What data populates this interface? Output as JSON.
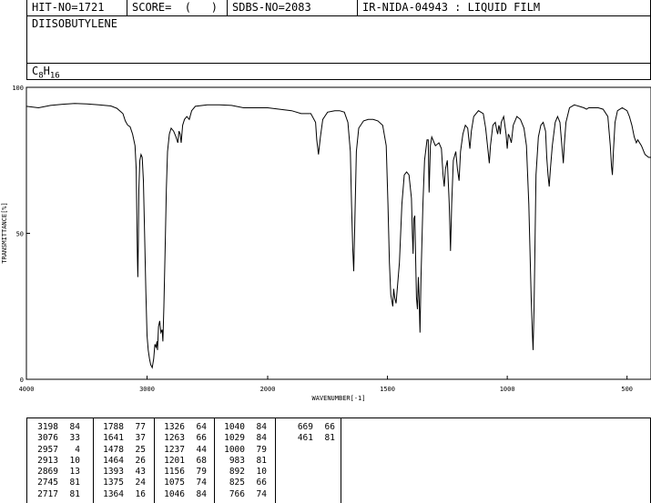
{
  "header": {
    "hit_no": "HIT-NO=1721",
    "score": "SCORE=  (   )",
    "sdbs_no": "SDBS-NO=2083",
    "ir_id": "IR-NIDA-04943 : LIQUID FILM"
  },
  "compound_name": "DIISOBUTYLENE",
  "formula": {
    "prefix": "C",
    "sub1": "8",
    "mid": "H",
    "sub2": "16"
  },
  "chart_data": {
    "type": "line",
    "xlabel": "WAVENUMBER[-1]",
    "ylabel": "TRANSMITTANCE[%]",
    "xlim": [
      4000,
      400
    ],
    "ylim": [
      0,
      100
    ],
    "x_ticks": [
      4000,
      3000,
      2000,
      1500,
      1000,
      500
    ],
    "y_ticks": [
      0,
      50,
      100
    ],
    "series": [
      {
        "points": [
          [
            4000,
            93.5
          ],
          [
            3900,
            93.0
          ],
          [
            3800,
            93.8
          ],
          [
            3700,
            94.2
          ],
          [
            3600,
            94.5
          ],
          [
            3500,
            94.3
          ],
          [
            3400,
            94.0
          ],
          [
            3300,
            93.6
          ],
          [
            3250,
            92.8
          ],
          [
            3200,
            91.0
          ],
          [
            3180,
            88.5
          ],
          [
            3160,
            87.0
          ],
          [
            3140,
            86.5
          ],
          [
            3120,
            84.0
          ],
          [
            3100,
            80.0
          ],
          [
            3090,
            72.0
          ],
          [
            3085,
            58.0
          ],
          [
            3080,
            42.0
          ],
          [
            3076,
            35.0
          ],
          [
            3072,
            48.0
          ],
          [
            3068,
            65.0
          ],
          [
            3060,
            75.0
          ],
          [
            3050,
            77.0
          ],
          [
            3040,
            76.0
          ],
          [
            3030,
            68.0
          ],
          [
            3020,
            50.0
          ],
          [
            3010,
            30.0
          ],
          [
            3000,
            15.0
          ],
          [
            2990,
            10.0
          ],
          [
            2980,
            7.0
          ],
          [
            2970,
            5.0
          ],
          [
            2957,
            4.0
          ],
          [
            2945,
            7.0
          ],
          [
            2935,
            12.0
          ],
          [
            2925,
            11.0
          ],
          [
            2918,
            13.0
          ],
          [
            2913,
            10.0
          ],
          [
            2905,
            18.0
          ],
          [
            2895,
            20.0
          ],
          [
            2885,
            16.0
          ],
          [
            2875,
            17.0
          ],
          [
            2869,
            13.0
          ],
          [
            2860,
            25.0
          ],
          [
            2850,
            45.0
          ],
          [
            2840,
            65.0
          ],
          [
            2830,
            78.0
          ],
          [
            2815,
            84.0
          ],
          [
            2800,
            86.0
          ],
          [
            2780,
            85.0
          ],
          [
            2760,
            83.0
          ],
          [
            2745,
            81.0
          ],
          [
            2735,
            85.0
          ],
          [
            2725,
            84.0
          ],
          [
            2717,
            81.0
          ],
          [
            2705,
            87.0
          ],
          [
            2690,
            89.0
          ],
          [
            2670,
            90.0
          ],
          [
            2650,
            89.0
          ],
          [
            2630,
            92.0
          ],
          [
            2600,
            93.5
          ],
          [
            2500,
            94.0
          ],
          [
            2400,
            94.0
          ],
          [
            2300,
            93.8
          ],
          [
            2200,
            93.0
          ],
          [
            2100,
            93.0
          ],
          [
            2000,
            93.0
          ],
          [
            1950,
            92.5
          ],
          [
            1900,
            92.0
          ],
          [
            1860,
            91.0
          ],
          [
            1820,
            91.0
          ],
          [
            1800,
            88.0
          ],
          [
            1795,
            82.0
          ],
          [
            1788,
            77.0
          ],
          [
            1780,
            83.0
          ],
          [
            1770,
            89.0
          ],
          [
            1750,
            91.5
          ],
          [
            1720,
            92.0
          ],
          [
            1700,
            92.0
          ],
          [
            1680,
            91.5
          ],
          [
            1665,
            88.0
          ],
          [
            1655,
            78.0
          ],
          [
            1650,
            60.0
          ],
          [
            1645,
            45.0
          ],
          [
            1641,
            37.0
          ],
          [
            1636,
            55.0
          ],
          [
            1630,
            78.0
          ],
          [
            1620,
            86.0
          ],
          [
            1600,
            88.5
          ],
          [
            1580,
            89.0
          ],
          [
            1560,
            89.0
          ],
          [
            1540,
            88.5
          ],
          [
            1520,
            87.0
          ],
          [
            1505,
            80.0
          ],
          [
            1498,
            60.0
          ],
          [
            1492,
            40.0
          ],
          [
            1486,
            29.0
          ],
          [
            1482,
            27.0
          ],
          [
            1478,
            25.0
          ],
          [
            1474,
            31.0
          ],
          [
            1470,
            28.0
          ],
          [
            1464,
            26.0
          ],
          [
            1458,
            32.0
          ],
          [
            1450,
            40.0
          ],
          [
            1440,
            60.0
          ],
          [
            1430,
            70.0
          ],
          [
            1420,
            71.0
          ],
          [
            1410,
            70.0
          ],
          [
            1400,
            62.0
          ],
          [
            1396,
            50.0
          ],
          [
            1393,
            43.0
          ],
          [
            1390,
            55.0
          ],
          [
            1386,
            56.0
          ],
          [
            1382,
            40.0
          ],
          [
            1379,
            28.0
          ],
          [
            1375,
            24.0
          ],
          [
            1371,
            35.0
          ],
          [
            1368,
            28.0
          ],
          [
            1364,
            16.0
          ],
          [
            1360,
            35.0
          ],
          [
            1352,
            60.0
          ],
          [
            1345,
            75.0
          ],
          [
            1335,
            82.0
          ],
          [
            1330,
            82.0
          ],
          [
            1326,
            64.0
          ],
          [
            1321,
            80.0
          ],
          [
            1315,
            83.0
          ],
          [
            1300,
            80.0
          ],
          [
            1285,
            81.0
          ],
          [
            1275,
            79.0
          ],
          [
            1268,
            70.0
          ],
          [
            1263,
            66.0
          ],
          [
            1258,
            72.0
          ],
          [
            1250,
            75.0
          ],
          [
            1242,
            60.0
          ],
          [
            1237,
            44.0
          ],
          [
            1232,
            60.0
          ],
          [
            1225,
            75.0
          ],
          [
            1215,
            78.0
          ],
          [
            1208,
            72.0
          ],
          [
            1201,
            68.0
          ],
          [
            1195,
            78.0
          ],
          [
            1185,
            84.0
          ],
          [
            1175,
            87.0
          ],
          [
            1165,
            86.0
          ],
          [
            1160,
            82.0
          ],
          [
            1156,
            79.0
          ],
          [
            1150,
            85.0
          ],
          [
            1140,
            90.0
          ],
          [
            1120,
            92.0
          ],
          [
            1100,
            91.0
          ],
          [
            1090,
            86.0
          ],
          [
            1080,
            78.0
          ],
          [
            1075,
            74.0
          ],
          [
            1070,
            80.0
          ],
          [
            1060,
            87.0
          ],
          [
            1050,
            88.0
          ],
          [
            1043,
            85.0
          ],
          [
            1040,
            84.0
          ],
          [
            1035,
            87.0
          ],
          [
            1032,
            86.0
          ],
          [
            1029,
            84.0
          ],
          [
            1025,
            88.0
          ],
          [
            1015,
            90.0
          ],
          [
            1005,
            84.0
          ],
          [
            1000,
            79.0
          ],
          [
            995,
            84.0
          ],
          [
            990,
            83.0
          ],
          [
            983,
            81.0
          ],
          [
            975,
            87.0
          ],
          [
            960,
            90.0
          ],
          [
            945,
            89.0
          ],
          [
            930,
            86.0
          ],
          [
            920,
            80.0
          ],
          [
            910,
            60.0
          ],
          [
            900,
            28.0
          ],
          [
            895,
            15.0
          ],
          [
            892,
            10.0
          ],
          [
            888,
            25.0
          ],
          [
            880,
            70.0
          ],
          [
            870,
            83.0
          ],
          [
            860,
            87.0
          ],
          [
            850,
            88.0
          ],
          [
            840,
            85.0
          ],
          [
            835,
            76.0
          ],
          [
            830,
            70.0
          ],
          [
            825,
            66.0
          ],
          [
            820,
            72.0
          ],
          [
            812,
            80.0
          ],
          [
            800,
            88.0
          ],
          [
            790,
            90.0
          ],
          [
            780,
            88.0
          ],
          [
            772,
            80.0
          ],
          [
            768,
            76.0
          ],
          [
            766,
            74.0
          ],
          [
            762,
            80.0
          ],
          [
            755,
            88.0
          ],
          [
            740,
            93.0
          ],
          [
            720,
            94.0
          ],
          [
            700,
            93.5
          ],
          [
            680,
            93.0
          ],
          [
            669,
            92.5
          ],
          [
            660,
            93.0
          ],
          [
            640,
            93.0
          ],
          [
            620,
            93.0
          ],
          [
            600,
            92.5
          ],
          [
            580,
            90.0
          ],
          [
            570,
            80.0
          ],
          [
            565,
            73.0
          ],
          [
            561,
            70.0
          ],
          [
            557,
            78.0
          ],
          [
            550,
            88.0
          ],
          [
            540,
            92.0
          ],
          [
            520,
            93.0
          ],
          [
            500,
            92.0
          ],
          [
            490,
            90.0
          ],
          [
            480,
            87.0
          ],
          [
            470,
            83.0
          ],
          [
            461,
            81.0
          ],
          [
            455,
            82.0
          ],
          [
            440,
            80.0
          ],
          [
            425,
            77.0
          ],
          [
            410,
            76.0
          ],
          [
            400,
            76.0
          ]
        ]
      }
    ]
  },
  "peak_table": [
    [
      [
        "3198",
        "84"
      ],
      [
        "3076",
        "33"
      ],
      [
        "2957",
        "4"
      ],
      [
        "2913",
        "10"
      ],
      [
        "2869",
        "13"
      ],
      [
        "2745",
        "81"
      ],
      [
        "2717",
        "81"
      ]
    ],
    [
      [
        "1788",
        "77"
      ],
      [
        "1641",
        "37"
      ],
      [
        "1478",
        "25"
      ],
      [
        "1464",
        "26"
      ],
      [
        "1393",
        "43"
      ],
      [
        "1375",
        "24"
      ],
      [
        "1364",
        "16"
      ]
    ],
    [
      [
        "1326",
        "64"
      ],
      [
        "1263",
        "66"
      ],
      [
        "1237",
        "44"
      ],
      [
        "1201",
        "68"
      ],
      [
        "1156",
        "79"
      ],
      [
        "1075",
        "74"
      ],
      [
        "1046",
        "84"
      ]
    ],
    [
      [
        "1040",
        "84"
      ],
      [
        "1029",
        "84"
      ],
      [
        "1000",
        "79"
      ],
      [
        "983",
        "81"
      ],
      [
        "892",
        "10"
      ],
      [
        "825",
        "66"
      ],
      [
        "766",
        "74"
      ]
    ],
    [
      [
        "669",
        "66"
      ],
      [
        "461",
        "81"
      ]
    ]
  ]
}
